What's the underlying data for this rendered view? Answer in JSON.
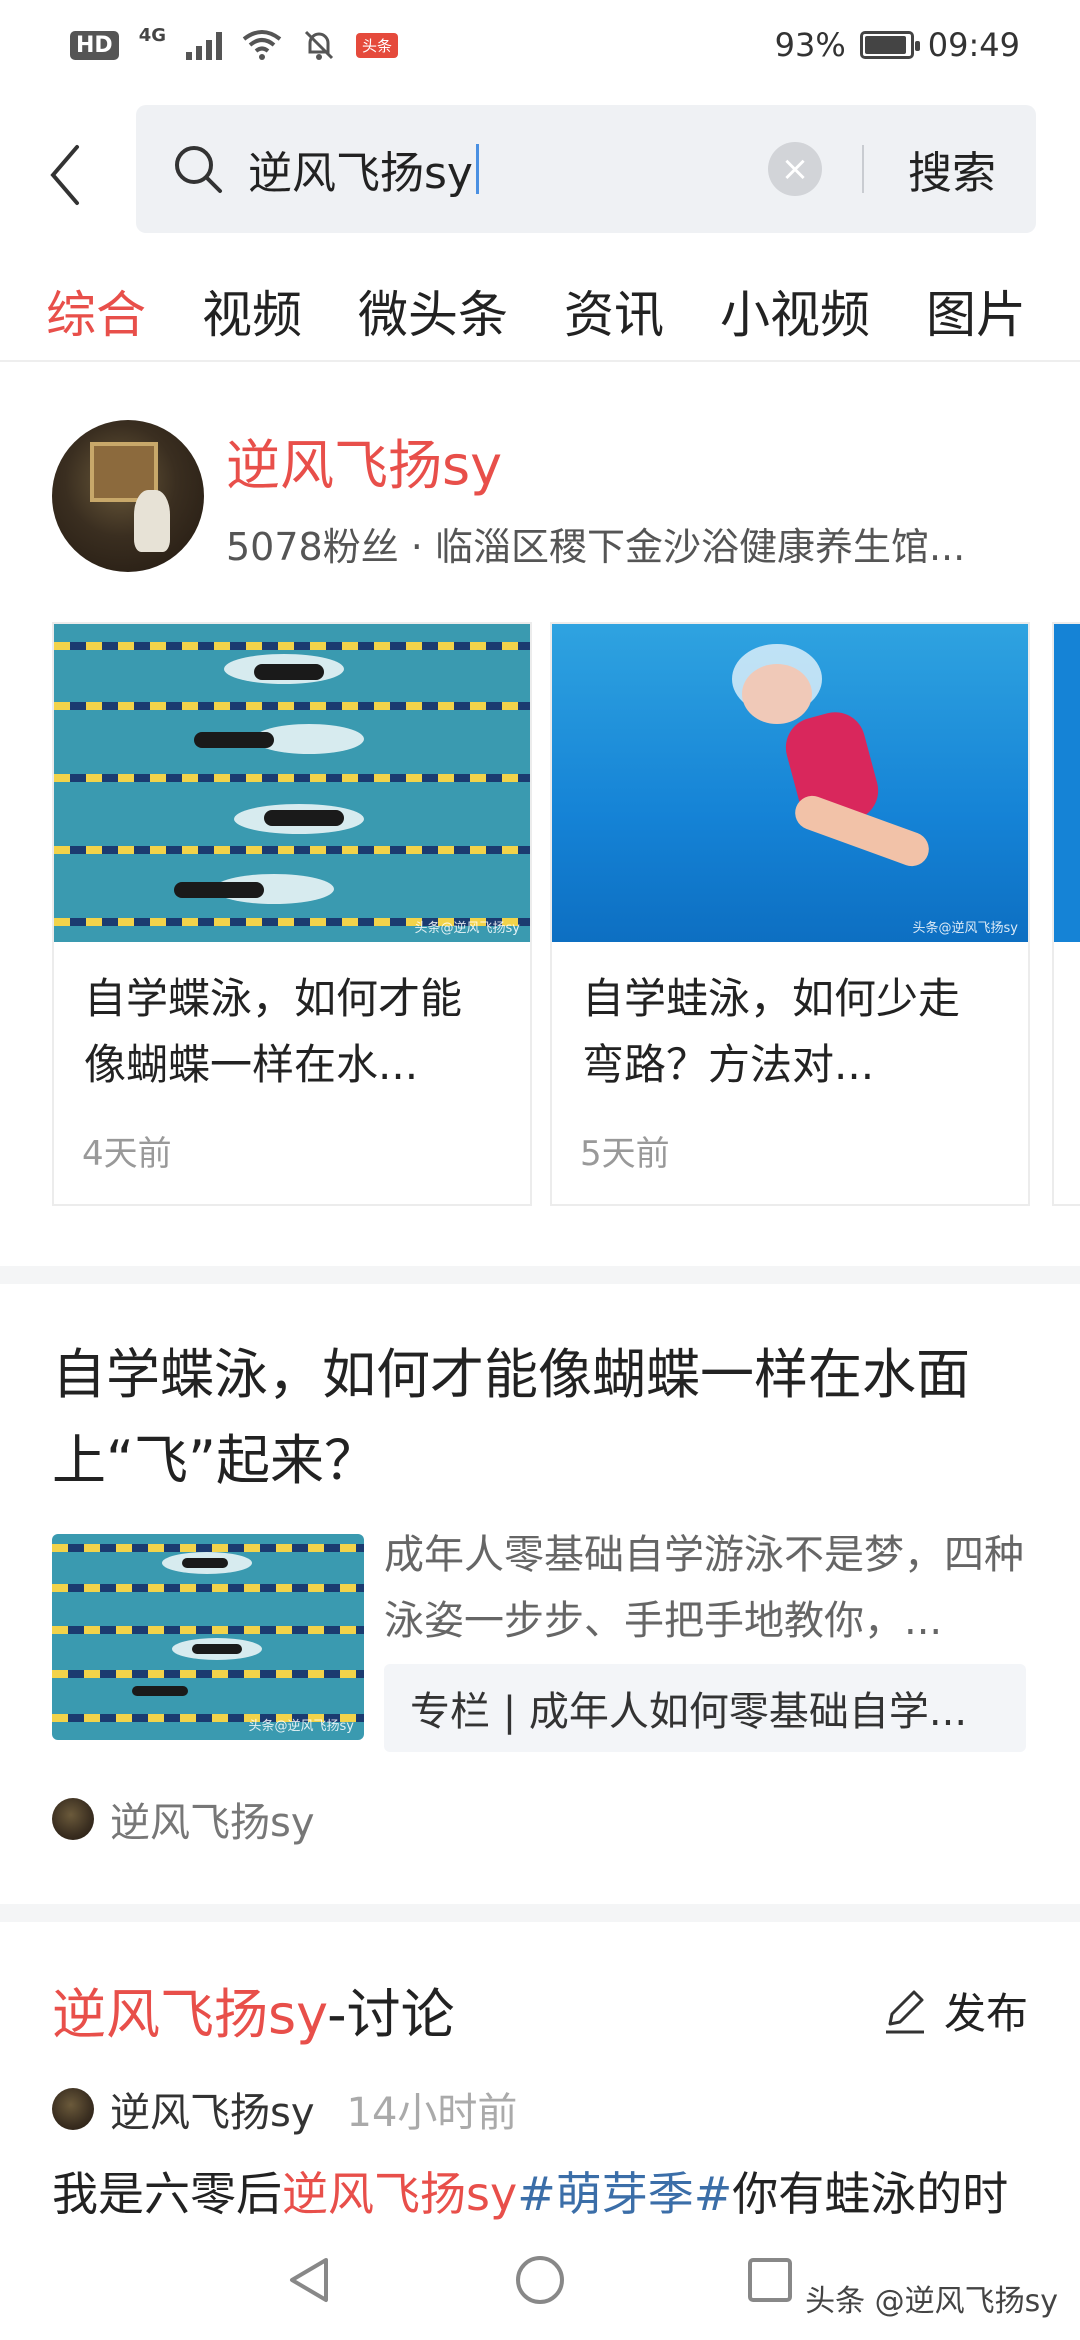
{
  "status_bar": {
    "hd": "HD",
    "network": "4G",
    "app_badge": "头条",
    "battery": "93%",
    "time": "09:49"
  },
  "search": {
    "query": "逆风飞扬sy",
    "submit_label": "搜索"
  },
  "tabs": [
    {
      "label": "综合",
      "active": true
    },
    {
      "label": "视频",
      "active": false
    },
    {
      "label": "微头条",
      "active": false
    },
    {
      "label": "资讯",
      "active": false
    },
    {
      "label": "小视频",
      "active": false
    },
    {
      "label": "图片",
      "active": false
    }
  ],
  "author_card": {
    "name": "逆风飞扬sy",
    "meta": "5078粉丝 · 临淄区稷下金沙浴健康养生馆..."
  },
  "cards": [
    {
      "title": "自学蝶泳，如何才能像蝴蝶一样在水...",
      "time": "4天前",
      "watermark": "头条@逆风飞扬sy"
    },
    {
      "title": "自学蛙泳，如何少走弯路？方法对...",
      "time": "5天前",
      "watermark": "头条@逆风飞扬sy"
    }
  ],
  "article": {
    "title": "自学蝶泳，如何才能像蝴蝶一样在水面上“飞”起来？",
    "abstract": "成年人零基础自学游泳不是梦，四种泳姿一步步、手把手地教你，...",
    "column_link": "专栏 | 成年人如何零基础自学...",
    "author": "逆风飞扬sy",
    "thumb_watermark": "头条@逆风飞扬sy"
  },
  "discussion": {
    "title_highlight": "逆风飞扬sy",
    "title_suffix": "-讨论",
    "publish_label": "发布",
    "post_author": "逆风飞扬sy",
    "post_time": "14小时前",
    "post_prefix": "我是六零后",
    "post_highlight": "逆风飞扬sy",
    "post_tag": "#萌芽季#",
    "post_suffix": "你有蛙泳的时"
  },
  "footer_watermark": "头条 @逆风飞扬sy",
  "colors": {
    "accent": "#e84f4a",
    "tag_blue": "#3b6ea8"
  }
}
